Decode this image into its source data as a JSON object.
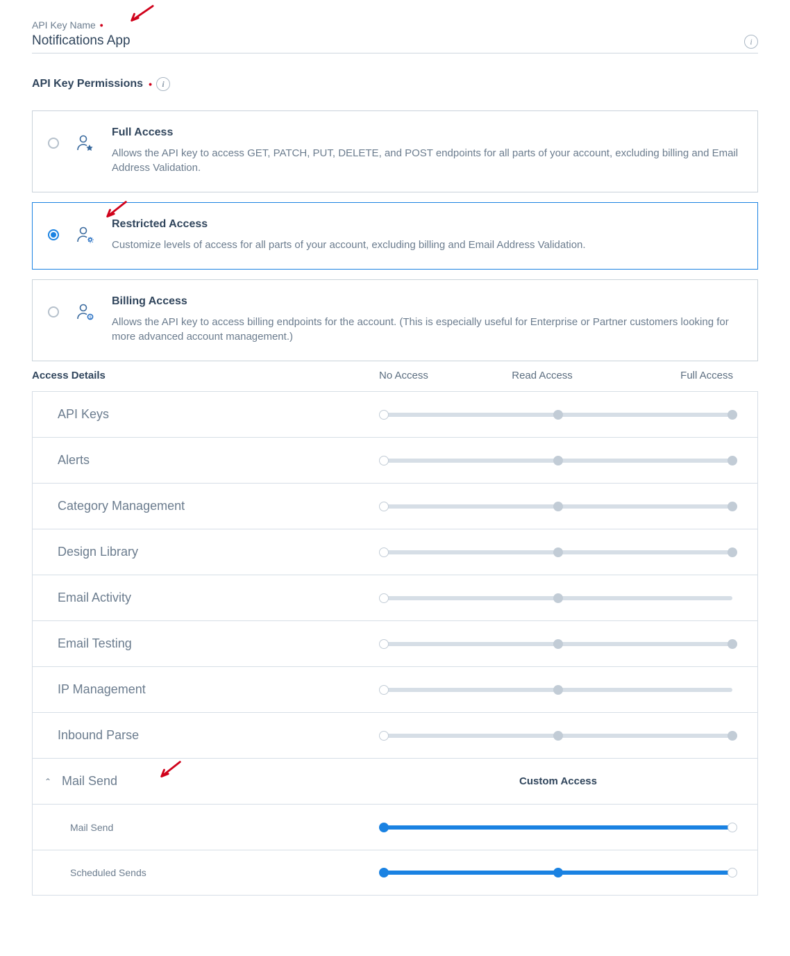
{
  "field": {
    "label": "API Key Name",
    "value": "Notifications App"
  },
  "permissionsTitle": "API Key Permissions",
  "options": {
    "full": {
      "title": "Full Access",
      "desc": "Allows the API key to access GET, PATCH, PUT, DELETE, and POST endpoints for all parts of your account, excluding billing and Email Address Validation."
    },
    "restricted": {
      "title": "Restricted Access",
      "desc": "Customize levels of access for all parts of your account, excluding billing and Email Address Validation."
    },
    "billing": {
      "title": "Billing Access",
      "desc": "Allows the API key to access billing endpoints for the account. (This is especially useful for Enterprise or Partner customers looking for more advanced account management.)"
    }
  },
  "detailsTitle": "Access Details",
  "cols": {
    "no": "No Access",
    "read": "Read Access",
    "full": "Full Access"
  },
  "rows": {
    "api_keys": "API Keys",
    "alerts": "Alerts",
    "category": "Category Management",
    "design": "Design Library",
    "email_activity": "Email Activity",
    "email_testing": "Email Testing",
    "ip": "IP Management",
    "inbound": "Inbound Parse",
    "mail_send": "Mail Send",
    "custom": "Custom Access",
    "sub_mail_send": "Mail Send",
    "sub_scheduled": "Scheduled Sends"
  }
}
